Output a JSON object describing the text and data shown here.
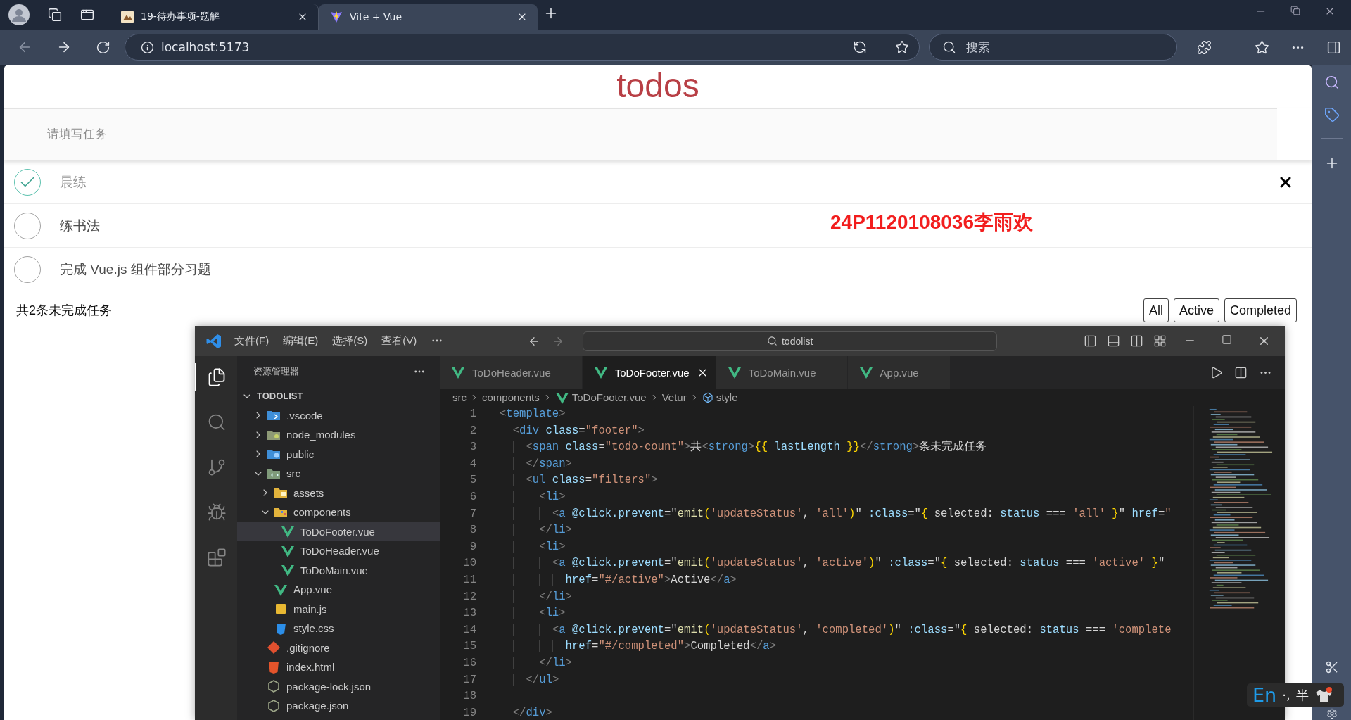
{
  "browser": {
    "tabs": [
      {
        "title": "19-待办事项-题解",
        "selected": false
      },
      {
        "title": "Vite + Vue",
        "selected": true
      }
    ],
    "address": "localhost:5173",
    "search_placeholder": "搜索"
  },
  "todo_app": {
    "title": "todos",
    "input_placeholder": "请填写任务",
    "items": [
      {
        "text": "晨练",
        "done": true,
        "hovered": true
      },
      {
        "text": "练书法",
        "done": false,
        "hovered": false
      },
      {
        "text": "完成 Vue.js 组件部分习题",
        "done": false,
        "hovered": false
      }
    ],
    "note": "24P1120108036李雨欢",
    "footer": {
      "count_text": "共2条未完成任务",
      "filters": [
        "All",
        "Active",
        "Completed"
      ]
    }
  },
  "editor": {
    "menu": [
      "文件(F)",
      "编辑(E)",
      "选择(S)",
      "查看(V)"
    ],
    "search": "todolist",
    "explorer_title": "资源管理器",
    "section": {
      "title": "TODOLIST",
      "expanded": true
    },
    "tree": [
      {
        "name": ".vscode",
        "kind": "config",
        "expanded": false,
        "selected": false
      },
      {
        "name": "node_modules",
        "kind": "modules",
        "expanded": false,
        "selected": false
      },
      {
        "name": "public",
        "kind": "public",
        "expanded": false,
        "selected": false
      },
      {
        "name": "src",
        "kind": "source",
        "expanded": true,
        "selected": false,
        "children": [
          {
            "name": "assets",
            "kind": "assets",
            "expanded": false,
            "selected": false
          },
          {
            "name": "components",
            "kind": "components",
            "expanded": true,
            "selected": false,
            "children": [
              {
                "name": "ToDoFooter.vue",
                "kind": "vue",
                "selected": true
              },
              {
                "name": "ToDoHeader.vue",
                "kind": "vue",
                "selected": false
              },
              {
                "name": "ToDoMain.vue",
                "kind": "vue",
                "selected": false
              }
            ]
          },
          {
            "name": "App.vue",
            "kind": "vue",
            "selected": false
          },
          {
            "name": "main.js",
            "kind": "js",
            "selected": false
          },
          {
            "name": "style.css",
            "kind": "css",
            "selected": false
          }
        ]
      },
      {
        "name": ".gitignore",
        "kind": "git",
        "selected": false
      },
      {
        "name": "index.html",
        "kind": "html",
        "selected": false
      },
      {
        "name": "package-lock.json",
        "kind": "json",
        "selected": false
      },
      {
        "name": "package.json",
        "kind": "json",
        "selected": false
      }
    ],
    "tabs": [
      {
        "label": "ToDoHeader.vue",
        "selected": false
      },
      {
        "label": "ToDoFooter.vue",
        "selected": true
      },
      {
        "label": "ToDoMain.vue",
        "selected": false
      },
      {
        "label": "App.vue",
        "selected": false
      }
    ],
    "breadcrumb": [
      {
        "label": "src",
        "kind": "plain"
      },
      {
        "label": "components",
        "kind": "plain"
      },
      {
        "label": "ToDoFooter.vue",
        "kind": "vue"
      },
      {
        "label": "Vetur",
        "kind": "plain"
      },
      {
        "label": "style",
        "kind": "symbol"
      }
    ],
    "lines": [
      {
        "number": "1",
        "tokens": [
          {
            "kind": "punct",
            "text": "<"
          },
          {
            "kind": "tag",
            "text": "template"
          },
          {
            "kind": "punct",
            "text": ">"
          }
        ]
      },
      {
        "number": "2",
        "tokens": [
          {
            "kind": "punct",
            "text": "  <"
          },
          {
            "kind": "tag",
            "text": "div"
          },
          {
            "kind": "attr",
            "text": " class"
          },
          {
            "kind": "plain",
            "text": "="
          },
          {
            "kind": "str",
            "text": "\"footer\""
          },
          {
            "kind": "punct",
            "text": ">"
          }
        ]
      },
      {
        "number": "3",
        "tokens": [
          {
            "kind": "punct",
            "text": "    <"
          },
          {
            "kind": "tag",
            "text": "span"
          },
          {
            "kind": "attr",
            "text": " class"
          },
          {
            "kind": "plain",
            "text": "="
          },
          {
            "kind": "str",
            "text": "\"todo-count\""
          },
          {
            "kind": "punct",
            "text": ">"
          },
          {
            "kind": "plain",
            "text": "共"
          },
          {
            "kind": "punct",
            "text": "<"
          },
          {
            "kind": "tag",
            "text": "strong"
          },
          {
            "kind": "punct",
            "text": ">"
          },
          {
            "kind": "brace",
            "text": "{{"
          },
          {
            "kind": "ident",
            "text": " lastLength "
          },
          {
            "kind": "brace",
            "text": "}}"
          },
          {
            "kind": "punct",
            "text": "</"
          },
          {
            "kind": "tag",
            "text": "strong"
          },
          {
            "kind": "punct",
            "text": ">"
          },
          {
            "kind": "plain",
            "text": "条未完成任务"
          }
        ]
      },
      {
        "number": "4",
        "tokens": [
          {
            "kind": "punct",
            "text": "    </"
          },
          {
            "kind": "tag",
            "text": "span"
          },
          {
            "kind": "punct",
            "text": ">"
          }
        ]
      },
      {
        "number": "5",
        "tokens": [
          {
            "kind": "punct",
            "text": "    <"
          },
          {
            "kind": "tag",
            "text": "ul"
          },
          {
            "kind": "attr",
            "text": " class"
          },
          {
            "kind": "plain",
            "text": "="
          },
          {
            "kind": "str",
            "text": "\"filters\""
          },
          {
            "kind": "punct",
            "text": ">"
          }
        ]
      },
      {
        "number": "6",
        "tokens": [
          {
            "kind": "punct",
            "text": "      <"
          },
          {
            "kind": "tag",
            "text": "li"
          },
          {
            "kind": "punct",
            "text": ">"
          }
        ]
      },
      {
        "number": "7",
        "tokens": [
          {
            "kind": "punct",
            "text": "        <"
          },
          {
            "kind": "tag",
            "text": "a"
          },
          {
            "kind": "attr",
            "text": " @click.prevent"
          },
          {
            "kind": "plain",
            "text": "=\""
          },
          {
            "kind": "fn",
            "text": "emit"
          },
          {
            "kind": "brace",
            "text": "("
          },
          {
            "kind": "str",
            "text": "'updateStatus'"
          },
          {
            "kind": "plain",
            "text": ", "
          },
          {
            "kind": "str",
            "text": "'all'"
          },
          {
            "kind": "brace",
            "text": ")"
          },
          {
            "kind": "plain",
            "text": "\" "
          },
          {
            "kind": "attr",
            "text": ":class"
          },
          {
            "kind": "plain",
            "text": "=\""
          },
          {
            "kind": "brace",
            "text": "{"
          },
          {
            "kind": "plain",
            "text": " selected: "
          },
          {
            "kind": "ident",
            "text": "status"
          },
          {
            "kind": "plain",
            "text": " === "
          },
          {
            "kind": "str",
            "text": "'all'"
          },
          {
            "kind": "brace",
            "text": " }"
          },
          {
            "kind": "plain",
            "text": "\" "
          },
          {
            "kind": "attr",
            "text": "href"
          },
          {
            "kind": "plain",
            "text": "="
          },
          {
            "kind": "str",
            "text": "\""
          }
        ]
      },
      {
        "number": "8",
        "tokens": [
          {
            "kind": "punct",
            "text": "      </"
          },
          {
            "kind": "tag",
            "text": "li"
          },
          {
            "kind": "punct",
            "text": ">"
          }
        ]
      },
      {
        "number": "9",
        "tokens": [
          {
            "kind": "punct",
            "text": "      <"
          },
          {
            "kind": "tag",
            "text": "li"
          },
          {
            "kind": "punct",
            "text": ">"
          }
        ]
      },
      {
        "number": "10",
        "tokens": [
          {
            "kind": "punct",
            "text": "        <"
          },
          {
            "kind": "tag",
            "text": "a"
          },
          {
            "kind": "attr",
            "text": " @click.prevent"
          },
          {
            "kind": "plain",
            "text": "=\""
          },
          {
            "kind": "fn",
            "text": "emit"
          },
          {
            "kind": "brace",
            "text": "("
          },
          {
            "kind": "str",
            "text": "'updateStatus'"
          },
          {
            "kind": "plain",
            "text": ", "
          },
          {
            "kind": "str",
            "text": "'active'"
          },
          {
            "kind": "brace",
            "text": ")"
          },
          {
            "kind": "plain",
            "text": "\" "
          },
          {
            "kind": "attr",
            "text": ":class"
          },
          {
            "kind": "plain",
            "text": "=\""
          },
          {
            "kind": "brace",
            "text": "{"
          },
          {
            "kind": "plain",
            "text": " selected: "
          },
          {
            "kind": "ident",
            "text": "status"
          },
          {
            "kind": "plain",
            "text": " === "
          },
          {
            "kind": "str",
            "text": "'active'"
          },
          {
            "kind": "brace",
            "text": " }"
          },
          {
            "kind": "plain",
            "text": "\""
          }
        ]
      },
      {
        "number": "11",
        "tokens": [
          {
            "kind": "attr",
            "text": "          href"
          },
          {
            "kind": "plain",
            "text": "="
          },
          {
            "kind": "str",
            "text": "\"#/active\""
          },
          {
            "kind": "punct",
            "text": ">"
          },
          {
            "kind": "plain",
            "text": "Active"
          },
          {
            "kind": "punct",
            "text": "</"
          },
          {
            "kind": "tag",
            "text": "a"
          },
          {
            "kind": "punct",
            "text": ">"
          }
        ]
      },
      {
        "number": "12",
        "tokens": [
          {
            "kind": "punct",
            "text": "      </"
          },
          {
            "kind": "tag",
            "text": "li"
          },
          {
            "kind": "punct",
            "text": ">"
          }
        ]
      },
      {
        "number": "13",
        "tokens": [
          {
            "kind": "punct",
            "text": "      <"
          },
          {
            "kind": "tag",
            "text": "li"
          },
          {
            "kind": "punct",
            "text": ">"
          }
        ]
      },
      {
        "number": "14",
        "tokens": [
          {
            "kind": "punct",
            "text": "        <"
          },
          {
            "kind": "tag",
            "text": "a"
          },
          {
            "kind": "attr",
            "text": " @click.prevent"
          },
          {
            "kind": "plain",
            "text": "=\""
          },
          {
            "kind": "fn",
            "text": "emit"
          },
          {
            "kind": "brace",
            "text": "("
          },
          {
            "kind": "str",
            "text": "'updateStatus'"
          },
          {
            "kind": "plain",
            "text": ", "
          },
          {
            "kind": "str",
            "text": "'completed'"
          },
          {
            "kind": "brace",
            "text": ")"
          },
          {
            "kind": "plain",
            "text": "\" "
          },
          {
            "kind": "attr",
            "text": ":class"
          },
          {
            "kind": "plain",
            "text": "=\""
          },
          {
            "kind": "brace",
            "text": "{"
          },
          {
            "kind": "plain",
            "text": " selected: "
          },
          {
            "kind": "ident",
            "text": "status"
          },
          {
            "kind": "plain",
            "text": " === "
          },
          {
            "kind": "str",
            "text": "'complete"
          }
        ]
      },
      {
        "number": "15",
        "tokens": [
          {
            "kind": "attr",
            "text": "          href"
          },
          {
            "kind": "plain",
            "text": "="
          },
          {
            "kind": "str",
            "text": "\"#/completed\""
          },
          {
            "kind": "punct",
            "text": ">"
          },
          {
            "kind": "plain",
            "text": "Completed"
          },
          {
            "kind": "punct",
            "text": "</"
          },
          {
            "kind": "tag",
            "text": "a"
          },
          {
            "kind": "punct",
            "text": ">"
          }
        ]
      },
      {
        "number": "16",
        "tokens": [
          {
            "kind": "punct",
            "text": "      </"
          },
          {
            "kind": "tag",
            "text": "li"
          },
          {
            "kind": "punct",
            "text": ">"
          }
        ]
      },
      {
        "number": "17",
        "tokens": [
          {
            "kind": "punct",
            "text": "    </"
          },
          {
            "kind": "tag",
            "text": "ul"
          },
          {
            "kind": "punct",
            "text": ">"
          }
        ]
      },
      {
        "number": "18"
      },
      {
        "number": "19",
        "tokens": [
          {
            "kind": "punct",
            "text": "  </"
          },
          {
            "kind": "tag",
            "text": "div"
          },
          {
            "kind": "punct",
            "text": ">"
          }
        ]
      }
    ]
  },
  "ime": {
    "mode": "En",
    "punctuation": "·,",
    "width": "半"
  }
}
